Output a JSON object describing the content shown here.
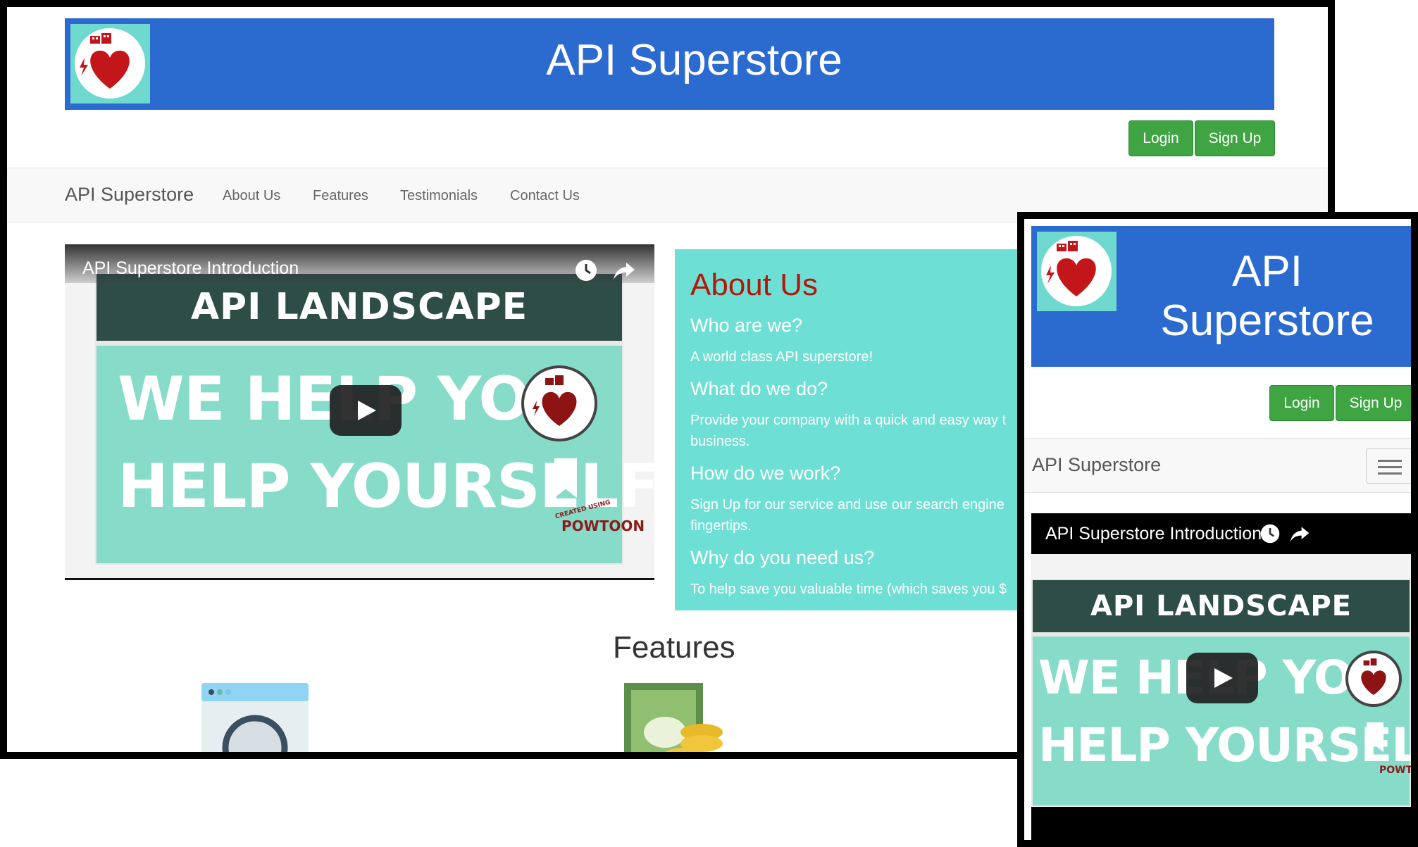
{
  "site": {
    "title": "API Superstore",
    "brand": "API Superstore",
    "brand_color": "#2b6acf",
    "accent_green": "#3ea542",
    "about_bg": "#6edfd4",
    "about_title_color": "#b5170d"
  },
  "auth": {
    "login_label": "Login",
    "signup_label": "Sign Up"
  },
  "nav": {
    "items": [
      {
        "label": "About Us"
      },
      {
        "label": "Features"
      },
      {
        "label": "Testimonials"
      },
      {
        "label": "Contact Us"
      }
    ]
  },
  "video": {
    "title": "API Superstore Introduction",
    "slide_heading": "API LANDSCAPE",
    "slide_line1": "WE HELP YOU",
    "slide_line2": "HELP YOURSELF",
    "watermark_small": "CREATED USING",
    "watermark": "POWTOON",
    "icons": [
      "clock-icon",
      "share-icon",
      "play-icon"
    ]
  },
  "about": {
    "title": "About Us",
    "q1": "Who are we?",
    "a1": "A world class API superstore!",
    "q2": "What do we do?",
    "a2": "Provide your company with a quick and easy way t",
    "a2b": "business.",
    "q3": "How do we work?",
    "a3": "Sign Up for our service and use our search engine",
    "a3b": "fingertips.",
    "q4": "Why do you need us?",
    "a4": "To help save you valuable time (which saves you $"
  },
  "features": {
    "title": "Features",
    "icons": [
      "search-window-icon",
      "money-coins-icon"
    ]
  },
  "mobile": {
    "title_line1": "API",
    "title_line2": "Superstore"
  }
}
